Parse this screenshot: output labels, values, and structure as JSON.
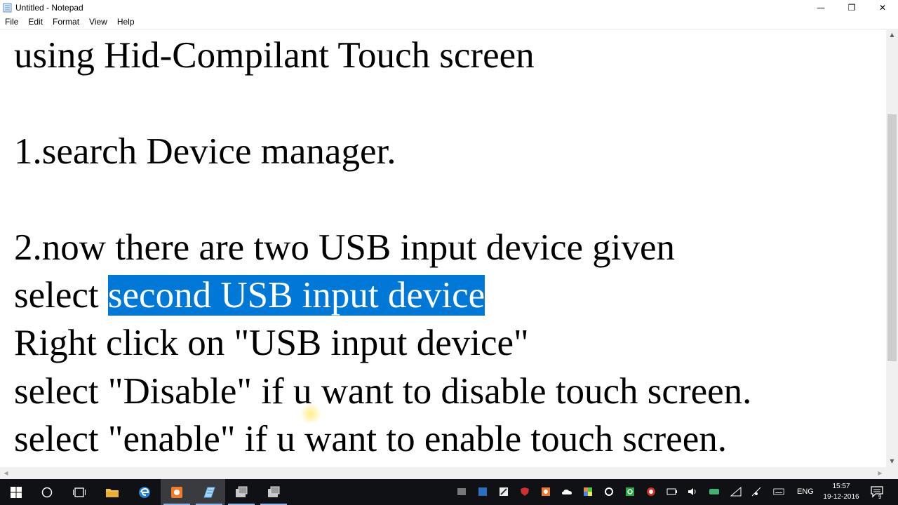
{
  "window": {
    "title": "Untitled - Notepad",
    "controls": {
      "minimize": "—",
      "maximize": "❐",
      "close": "✕"
    }
  },
  "menu": [
    "File",
    "Edit",
    "Format",
    "View",
    "Help"
  ],
  "document": {
    "lines": [
      "using Hid-Compilant Touch screen",
      "",
      "1.search Device manager.",
      "",
      "2.now there are two USB input device given",
      {
        "before": "select ",
        "selected": "second USB input device"
      },
      "Right click on \"USB input device\"",
      "select \"Disable\" if u want to disable touch screen.",
      "select \"enable\" if u want to enable touch screen."
    ]
  },
  "taskbar": {
    "apps": [
      "start-icon",
      "cortana-icon",
      "task-view-icon",
      "file-explorer-icon",
      "edge-icon",
      "screen-recorder-icon",
      "notepad-icon",
      "app-icon-1",
      "app-icon-2"
    ],
    "language": "ENG",
    "time": "15:57",
    "date": "19-12-2016",
    "notification_count": "9"
  },
  "colors": {
    "selection": "#0078d7",
    "taskbar": "#101114",
    "scrollbar_thumb": "#cdcdcd"
  }
}
